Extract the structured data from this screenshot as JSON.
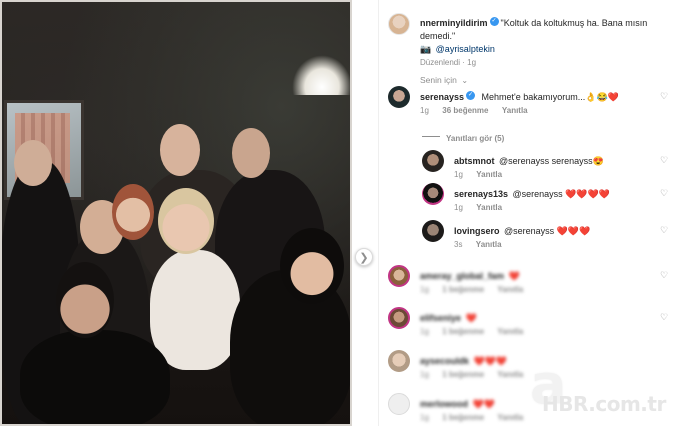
{
  "caption": {
    "username": "nnerminyildirim",
    "text": "\"Koltuk da koltukmuş ha. Bana mısın demedi.\"",
    "mention_prefix": "📷",
    "mention": "@ayrisalptekin",
    "meta": "Düzenlendi · 1g"
  },
  "sort_label": "Senin için",
  "comments": [
    {
      "username": "serenayss",
      "text": "Mehmet'e bakamıyorum...👌😂❤️",
      "time": "1g",
      "likes": "36 beğenme",
      "reply": "Yanıtla",
      "view_replies": "Yanıtları gör (5)",
      "replies": [
        {
          "username": "abtsmnot",
          "text": "@serenayss serenayss😍",
          "time": "1g",
          "reply": "Yanıtla"
        },
        {
          "username": "serenays13s",
          "text": "@serenayss ❤️❤️❤️❤️",
          "time": "1g",
          "reply": "Yanıtla"
        },
        {
          "username": "lovingsero",
          "text": "@serenayss ❤️❤️❤️",
          "time": "3s",
          "reply": "Yanıtla"
        }
      ]
    }
  ],
  "blurred_comments": [
    {
      "username": "ameray_global_fam",
      "text": "❤️",
      "time": "1g",
      "likes": "1 beğenme",
      "reply": "Yanıtla"
    },
    {
      "username": "elifseniye",
      "text": "❤️",
      "time": "1g",
      "likes": "1 beğenme",
      "reply": "Yanıtla"
    },
    {
      "username": "aysecouldk",
      "text": "❤️❤️❤️",
      "time": "1g",
      "likes": "1 beğenme",
      "reply": "Yanıtla"
    },
    {
      "username": "merlowood",
      "text": "❤️❤️",
      "time": "1g",
      "likes": "1 beğenme",
      "reply": "Yanıtla"
    }
  ],
  "icons": {
    "nav": "chevron-right-icon",
    "verified": "verified-badge-icon",
    "heart": "heart-outline-icon",
    "sort": "chevron-down-icon"
  },
  "watermark": {
    "logo_letter": "a",
    "text": "HBR.com.tr"
  },
  "colors": {
    "verified": "#3897f0",
    "muted": "#8e8e8e",
    "text": "#262626"
  }
}
